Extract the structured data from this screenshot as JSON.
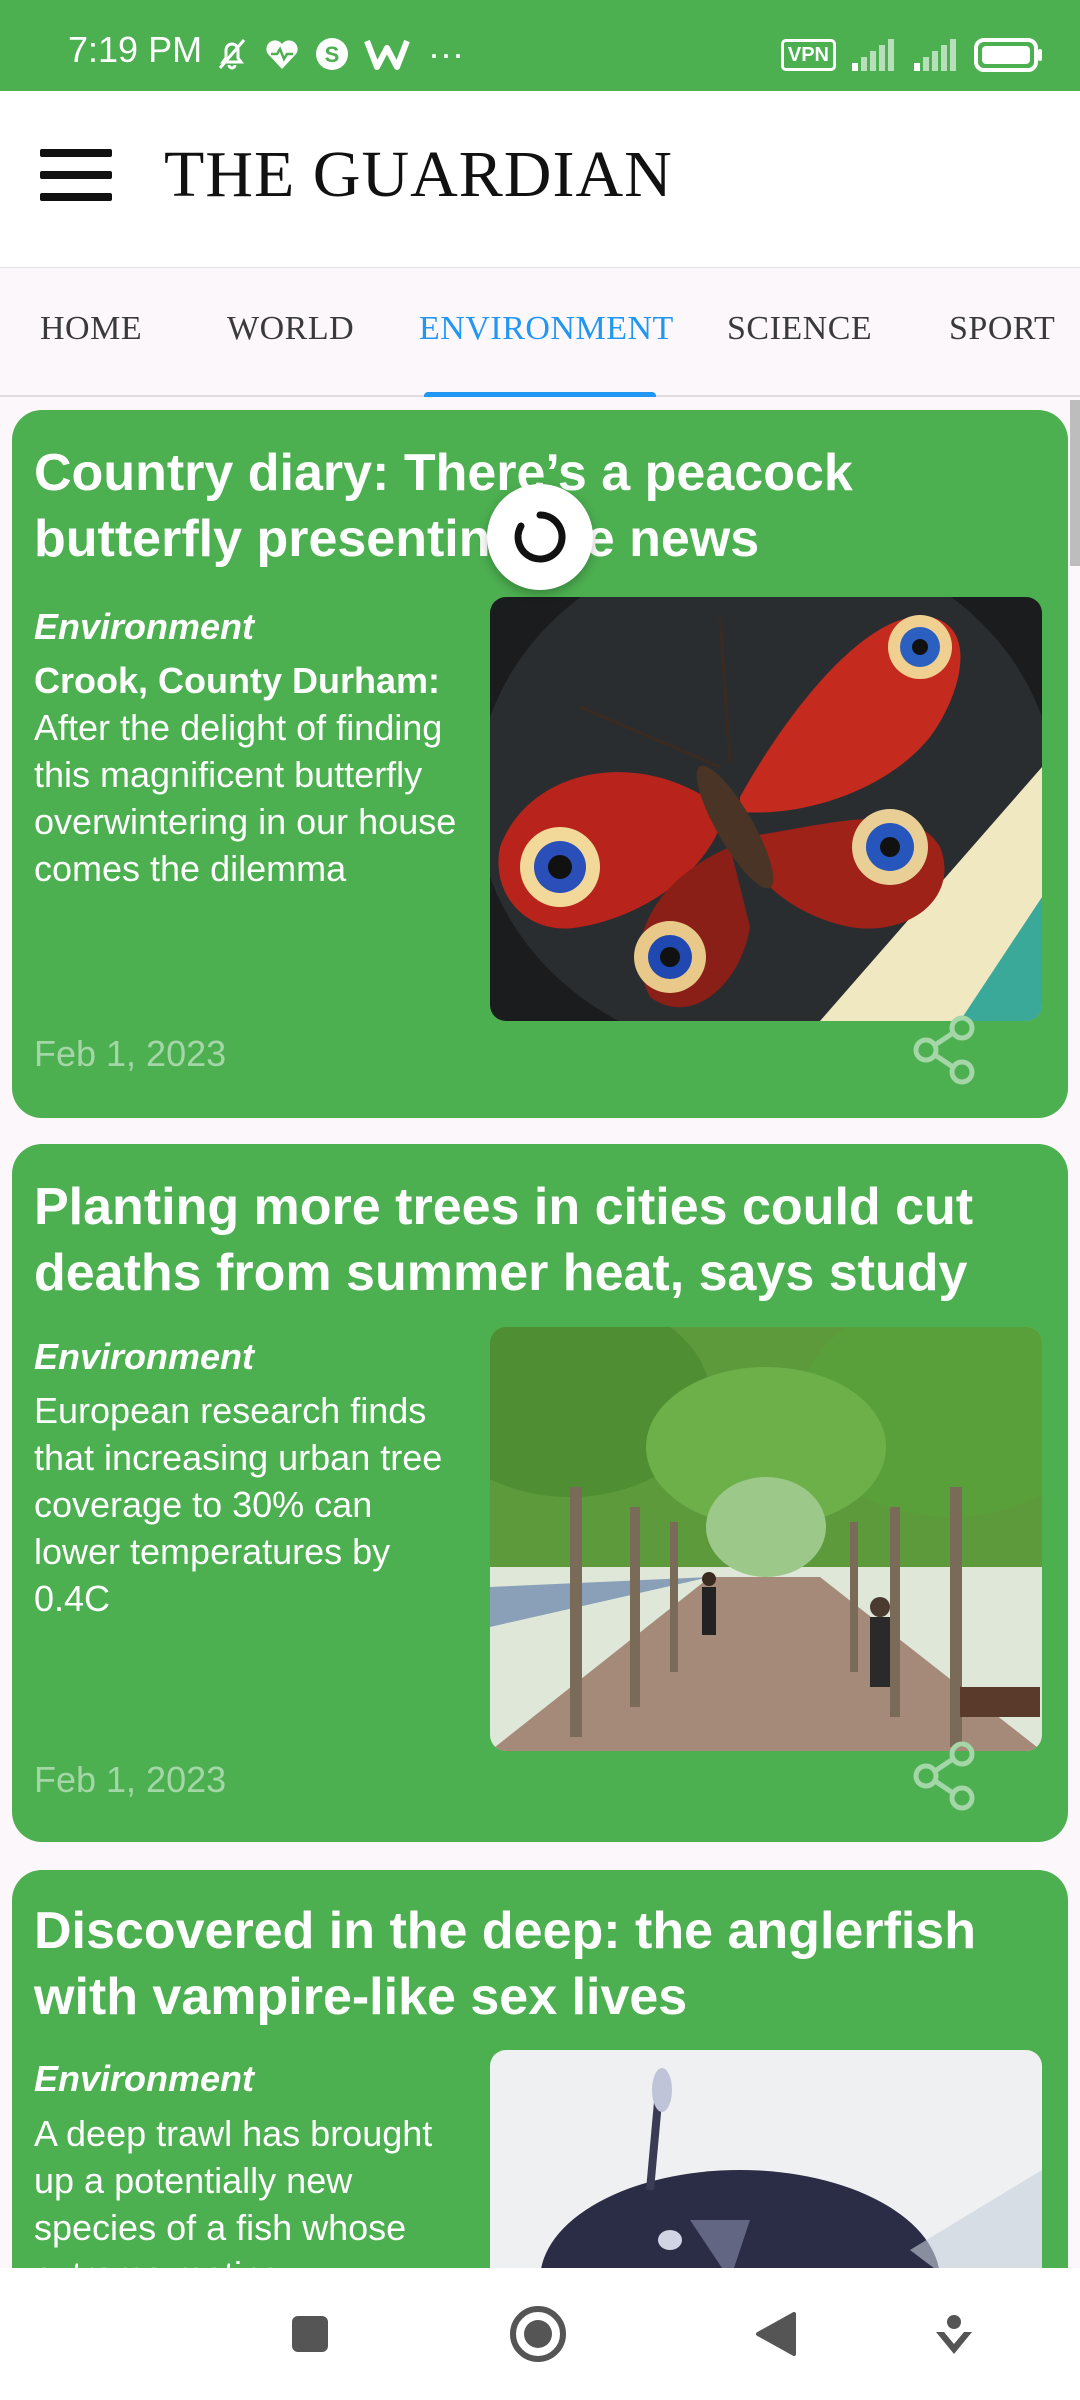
{
  "status_bar": {
    "time": "7:19 PM",
    "more": "···",
    "vpn": "VPN",
    "left_icons": [
      "mute-bell-icon",
      "health-heart-icon",
      "s-app-icon",
      "w-app-icon"
    ],
    "right_icons": [
      "vpn-icon",
      "signal-icon",
      "signal-icon",
      "battery-icon"
    ]
  },
  "app_bar": {
    "title": "THE GUARDIAN",
    "menu_icon": "hamburger-menu-icon"
  },
  "tabs": [
    {
      "label": "HOME",
      "active": false
    },
    {
      "label": "WORLD",
      "active": false
    },
    {
      "label": "ENVIRONMENT",
      "active": true
    },
    {
      "label": "SCIENCE",
      "active": false
    },
    {
      "label": "SPORT",
      "active": false
    }
  ],
  "articles": [
    {
      "title": "Country diary: There’s a peacock butterfly presenting the news",
      "section": "Environment",
      "trail_bold": "Crook, County Durham:",
      "trail": "After the delight of finding this magnificent butterfly overwintering in our house comes the dilemma",
      "date": "Feb 1, 2023",
      "image": "peacock-butterfly-photo"
    },
    {
      "title": "Planting more trees in cities could cut deaths from summer heat, says study",
      "section": "Environment",
      "trail_bold": "",
      "trail": "European research finds that increasing urban tree coverage to 30% can lower temperatures by 0.4C",
      "date": "Feb 1, 2023",
      "image": "tree-lined-walkway-photo"
    },
    {
      "title": "Discovered in the deep: the anglerfish with vampire-like sex lives",
      "section": "Environment",
      "trail_bold": "",
      "trail": "A deep trawl has brought up a potentially new species of a fish whose extreme mating",
      "date": "",
      "image": "anglerfish-photo"
    }
  ],
  "colors": {
    "card_green": "#4caf50",
    "accent_blue": "#2196f3",
    "date_green": "#a5d6a7",
    "tab_bg": "#fcf7fb"
  },
  "nav_bar": {
    "buttons": [
      "recents-square-icon",
      "home-circle-icon",
      "back-triangle-icon",
      "assistant-icon"
    ]
  }
}
